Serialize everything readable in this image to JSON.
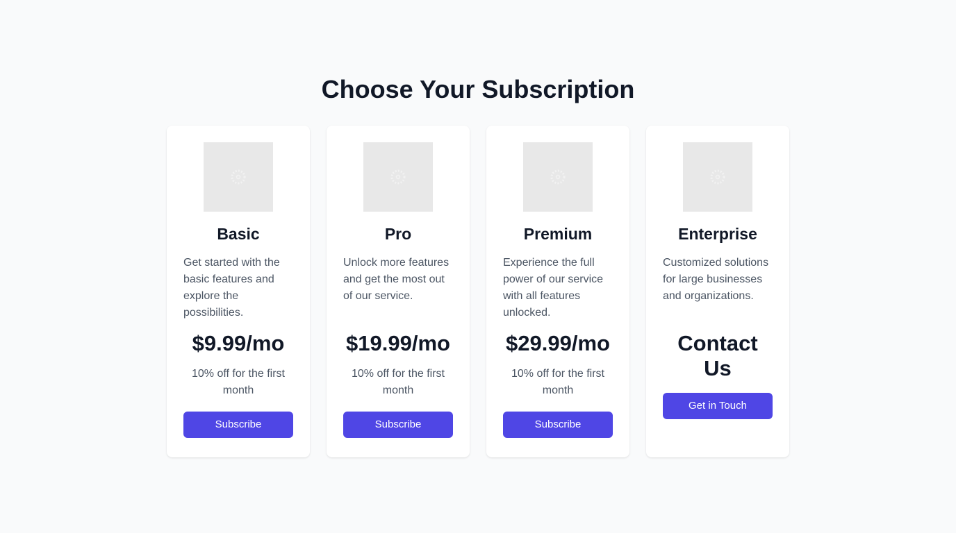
{
  "page": {
    "title": "Choose Your Subscription"
  },
  "colors": {
    "background": "#f9fafb",
    "card": "#ffffff",
    "accent": "#4f46e5",
    "heading": "#111827",
    "body_text": "#4b5563",
    "image_placeholder": "#e8e8e8"
  },
  "plans": [
    {
      "name": "Basic",
      "description": "Get started with the basic features and explore the possibilities.",
      "price": "$9.99/mo",
      "note": "10% off for the first month",
      "button_label": "Subscribe",
      "image_icon": "image-placeholder-icon"
    },
    {
      "name": "Pro",
      "description": "Unlock more features and get the most out of our service.",
      "price": "$19.99/mo",
      "note": "10% off for the first month",
      "button_label": "Subscribe",
      "image_icon": "image-placeholder-icon"
    },
    {
      "name": "Premium",
      "description": "Experience the full power of our service with all features unlocked.",
      "price": "$29.99/mo",
      "note": "10% off for the first month",
      "button_label": "Subscribe",
      "image_icon": "image-placeholder-icon"
    },
    {
      "name": "Enterprise",
      "description": "Customized solutions for large businesses and organizations.",
      "price": "Contact Us",
      "button_label": "Get in Touch",
      "image_icon": "image-placeholder-icon"
    }
  ]
}
